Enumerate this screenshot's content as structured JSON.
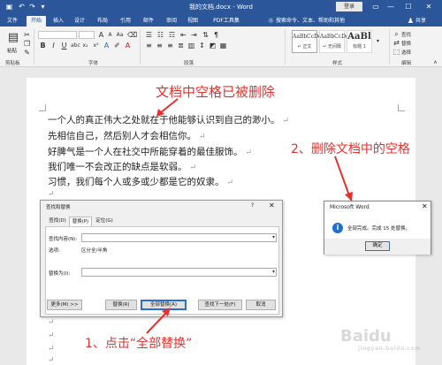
{
  "titlebar": {
    "doc_title": "我的文档.docx - Word",
    "login": "登录",
    "restore_icon": "ribbon-display-icon",
    "minimize": "—",
    "maximize": "☐",
    "close": "✕"
  },
  "tabs": {
    "items": [
      "文件",
      "开始",
      "插入",
      "设计",
      "布局",
      "引用",
      "邮件",
      "审阅",
      "视图",
      "PDF工具集"
    ],
    "active": "开始",
    "tell_me": "搜索命令、文本、帮助和其他",
    "share": "共享"
  },
  "ribbon": {
    "groups": {
      "clipboard": "剪贴板",
      "font": "字体",
      "paragraph": "段落",
      "styles": "样式",
      "editing": "编辑"
    },
    "paste_label": "粘贴",
    "styles": [
      {
        "sample": "AaBbCcDc",
        "name": "↵ 正文"
      },
      {
        "sample": "AaBbCcDc",
        "name": "↵ 无间隔"
      },
      {
        "sample": "AaBl",
        "name": "标题 1"
      }
    ],
    "editing": {
      "find": "查找",
      "replace": "替换",
      "select": "选择"
    }
  },
  "document": {
    "lines": [
      "一个人的真正伟大之处就在于他能够认识到自己的渺小。",
      "先相信自己，然后别人才会相信你。",
      "好脾气是一个人在社交中所能穿着的最佳服饰。",
      "我们唯一不会改正的缺点是软弱。",
      "习惯，我们每个人或多或少都是它的奴隶。"
    ],
    "para_mark": "↵"
  },
  "annotations": {
    "top": "文档中空格已被删除",
    "right": "2、删除文档中的空格",
    "bottom": "1、点击“全部替换”"
  },
  "find_replace_dialog": {
    "title": "查找和替换",
    "help": "?",
    "close": "✕",
    "tabs": [
      "查找(D)",
      "替换(P)",
      "定位(G)"
    ],
    "active_tab": "替换(P)",
    "find_label": "查找内容(N):",
    "find_value": "",
    "options_label": "选项:",
    "options_value": "区分全/半角",
    "replace_label": "替换为(I):",
    "replace_value": "",
    "buttons": {
      "more": "更多(M) >>",
      "replace": "替换(R)",
      "replace_all": "全部替换(A)",
      "find_next": "查找下一处(F)",
      "cancel": "取消"
    }
  },
  "message_box": {
    "title": "Microsoft Word",
    "close": "✕",
    "icon": "info-icon",
    "text": "全部完成。完成 15 处替换。",
    "ok": "确定"
  },
  "colors": {
    "word_blue": "#2b579a",
    "annotation_red": "#e8302b"
  }
}
